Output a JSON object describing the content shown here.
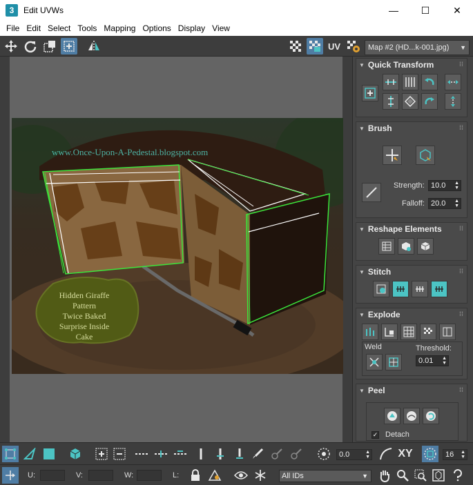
{
  "window": {
    "app_icon_glyph": "3",
    "title": "Edit UVWs",
    "minimize": "—",
    "maximize": "☐",
    "close": "✕"
  },
  "menu": [
    "File",
    "Edit",
    "Select",
    "Tools",
    "Mapping",
    "Options",
    "Display",
    "View"
  ],
  "toolbar": {
    "uv_label": "UV",
    "map_select": "Map #2 (HD...k-001.jpg)"
  },
  "image": {
    "watermark": "www.Once-Upon-A-Pedestal.blogspot.com",
    "badge_lines": [
      "Hidden Giraffe",
      "Pattern",
      "Twice Baked",
      "Surprise Inside",
      "Cake"
    ]
  },
  "panel": {
    "quick_transform": "Quick Transform",
    "brush": "Brush",
    "strength_label": "Strength:",
    "strength_value": "10.0",
    "falloff_label": "Falloff:",
    "falloff_value": "20.0",
    "reshape": "Reshape Elements",
    "stitch": "Stitch",
    "explode": "Explode",
    "weld": "Weld",
    "threshold_label": "Threshold:",
    "threshold_value": "0.01",
    "peel": "Peel",
    "detach_label": "Detach",
    "detach_checked": true
  },
  "bottom": {
    "rotate_value": "0.0",
    "xy_label": "XY",
    "grid_value": "16",
    "u_label": "U:",
    "v_label": "V:",
    "w_label": "W:",
    "l_label": "L:",
    "ids_select": "All IDs"
  },
  "colors": {
    "accent": "#4cc4c4",
    "uv_wire": "#3be63b",
    "selection": "#4f7da4"
  }
}
